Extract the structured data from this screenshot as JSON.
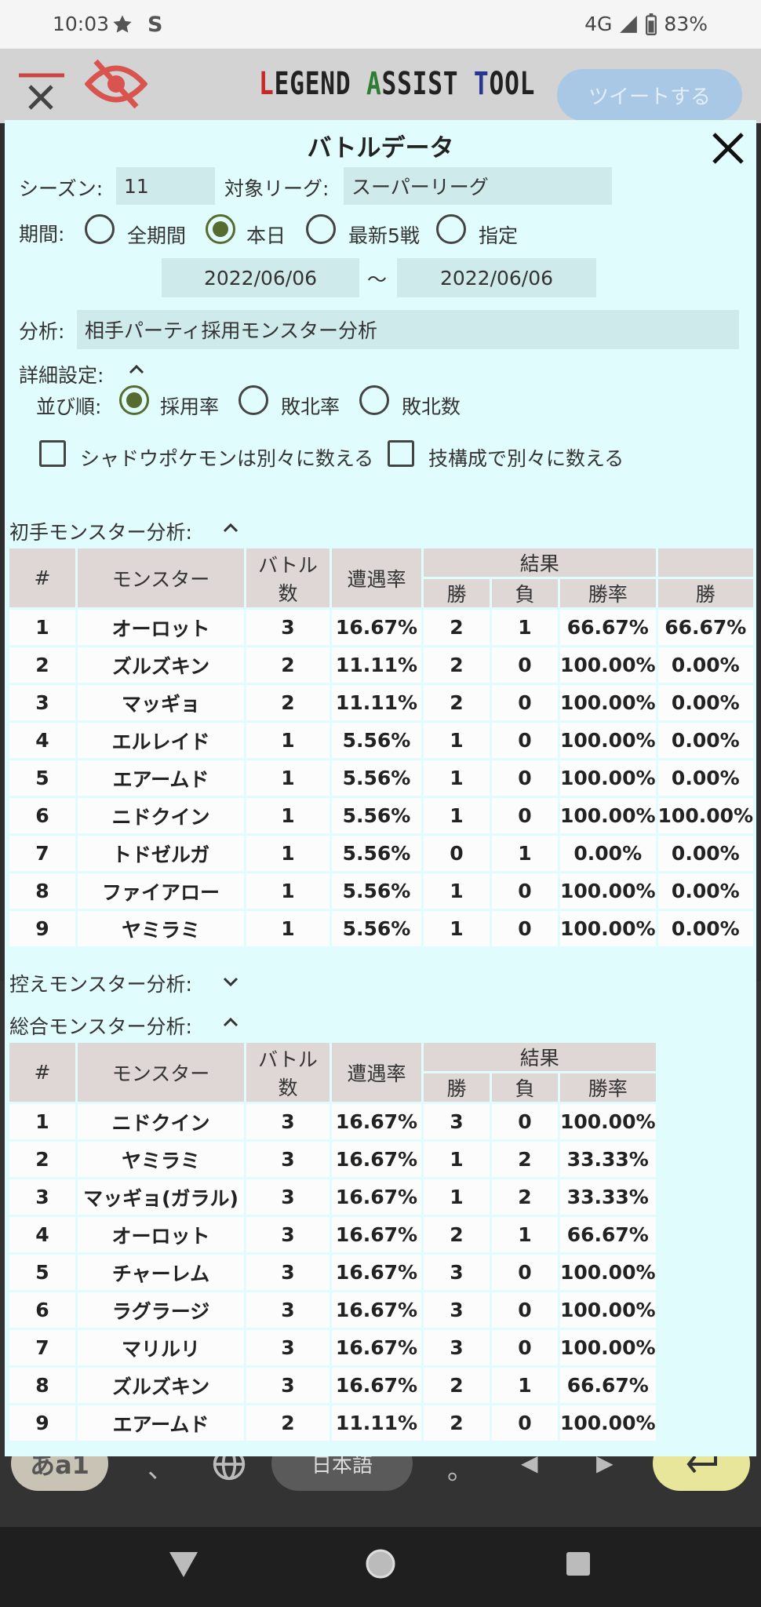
{
  "status": {
    "time": "10:03",
    "network": "4G",
    "battery": "83%"
  },
  "header": {
    "logo_a": "L",
    "logo_b": "EGEND ",
    "logo_c": "A",
    "logo_d": "SSIST ",
    "logo_e": "T",
    "logo_f": "OOL",
    "tweet_label": "ツイートする"
  },
  "dialog": {
    "title": "バトルデータ",
    "season_label": "シーズン:",
    "season_value": "11",
    "league_label": "対象リーグ:",
    "league_value": "スーパーリーグ",
    "period_label": "期間:",
    "period_options": [
      "全期間",
      "本日",
      "最新5戦",
      "指定"
    ],
    "period_selected": "本日",
    "date_from": "2022/06/06",
    "date_sep": "〜",
    "date_to": "2022/06/06",
    "analysis_label": "分析:",
    "analysis_value": "相手パーティ採用モンスター分析",
    "detail_label": "詳細設定:",
    "sort_label": "並び順:",
    "sort_options": [
      "採用率",
      "敗北率",
      "敗北数"
    ],
    "sort_selected": "採用率",
    "check_shadow": "シャドウポケモンは別々に数える",
    "check_moves": "技構成で別々に数える"
  },
  "lead": {
    "section_label": "初手モンスター分析:",
    "headers": {
      "idx": "#",
      "monster": "モンスター",
      "battles_1": "バトル",
      "battles_2": "数",
      "rate": "遭遇率",
      "result": "結果",
      "win": "勝",
      "loss": "負",
      "winrate": "勝率",
      "extra": "勝"
    },
    "rows": [
      [
        "1",
        "オーロット",
        "3",
        "16.67%",
        "2",
        "1",
        "66.67%",
        "66.67%"
      ],
      [
        "2",
        "ズルズキン",
        "2",
        "11.11%",
        "2",
        "0",
        "100.00%",
        "0.00%"
      ],
      [
        "3",
        "マッギョ",
        "2",
        "11.11%",
        "2",
        "0",
        "100.00%",
        "0.00%"
      ],
      [
        "4",
        "エルレイド",
        "1",
        "5.56%",
        "1",
        "0",
        "100.00%",
        "0.00%"
      ],
      [
        "5",
        "エアームド",
        "1",
        "5.56%",
        "1",
        "0",
        "100.00%",
        "0.00%"
      ],
      [
        "6",
        "ニドクイン",
        "1",
        "5.56%",
        "1",
        "0",
        "100.00%",
        "100.00%"
      ],
      [
        "7",
        "トドゼルガ",
        "1",
        "5.56%",
        "0",
        "1",
        "0.00%",
        "0.00%"
      ],
      [
        "8",
        "ファイアロー",
        "1",
        "5.56%",
        "1",
        "0",
        "100.00%",
        "0.00%"
      ],
      [
        "9",
        "ヤミラミ",
        "1",
        "5.56%",
        "1",
        "0",
        "100.00%",
        "0.00%"
      ]
    ]
  },
  "reserve": {
    "section_label": "控えモンスター分析:"
  },
  "total": {
    "section_label": "総合モンスター分析:",
    "headers": {
      "idx": "#",
      "monster": "モンスター",
      "battles_1": "バトル",
      "battles_2": "数",
      "rate": "遭遇率",
      "result": "結果",
      "win": "勝",
      "loss": "負",
      "winrate": "勝率"
    },
    "rows": [
      [
        "1",
        "ニドクイン",
        "3",
        "16.67%",
        "3",
        "0",
        "100.00%"
      ],
      [
        "2",
        "ヤミラミ",
        "3",
        "16.67%",
        "1",
        "2",
        "33.33%"
      ],
      [
        "3",
        "マッギョ(ガラル)",
        "3",
        "16.67%",
        "1",
        "2",
        "33.33%"
      ],
      [
        "4",
        "オーロット",
        "3",
        "16.67%",
        "2",
        "1",
        "66.67%"
      ],
      [
        "5",
        "チャーレム",
        "3",
        "16.67%",
        "3",
        "0",
        "100.00%"
      ],
      [
        "6",
        "ラグラージ",
        "3",
        "16.67%",
        "3",
        "0",
        "100.00%"
      ],
      [
        "7",
        "マリルリ",
        "3",
        "16.67%",
        "3",
        "0",
        "100.00%"
      ],
      [
        "8",
        "ズルズキン",
        "3",
        "16.67%",
        "2",
        "1",
        "66.67%"
      ],
      [
        "9",
        "エアームド",
        "2",
        "11.11%",
        "2",
        "0",
        "100.00%"
      ]
    ]
  },
  "keyboard": {
    "left_key": "あa1",
    "lang_key": "日本語",
    "comma": "、",
    "period": "。"
  }
}
